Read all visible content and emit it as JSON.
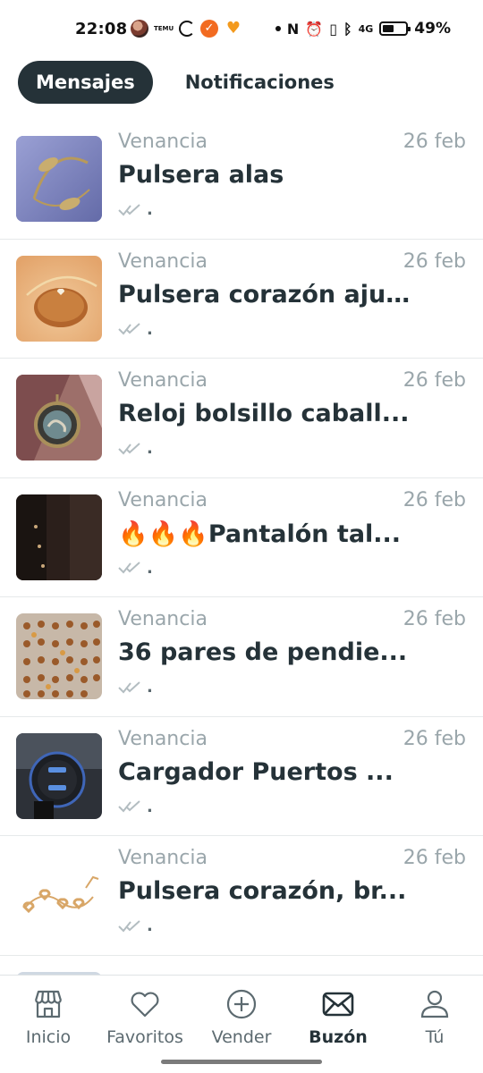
{
  "status_bar": {
    "time": "22:08",
    "temu_text": "TEMU",
    "battery_percent": "49%",
    "network": "4G"
  },
  "tabs": {
    "messages": "Mensajes",
    "notifications": "Notificaciones",
    "active": "messages"
  },
  "conversations": [
    {
      "sender": "Venancia",
      "date": "26 feb",
      "title": "Pulsera alas",
      "preview": ".",
      "thumb_icon": "bracelet-wings-photo"
    },
    {
      "sender": "Venancia",
      "date": "26 feb",
      "title": "Pulsera corazón aju...",
      "preview": ".",
      "thumb_icon": "heart-bracelet-photo"
    },
    {
      "sender": "Venancia",
      "date": "26 feb",
      "title": "Reloj bolsillo caball...",
      "preview": ".",
      "thumb_icon": "pocket-watch-photo"
    },
    {
      "sender": "Venancia",
      "date": "26 feb",
      "title": "🔥🔥🔥Pantalón tal...",
      "preview": ".",
      "thumb_icon": "trousers-photo"
    },
    {
      "sender": "Venancia",
      "date": "26 feb",
      "title": "36 pares de pendie...",
      "preview": ".",
      "thumb_icon": "earrings-photo"
    },
    {
      "sender": "Venancia",
      "date": "26 feb",
      "title": "Cargador Puertos ...",
      "preview": ".",
      "thumb_icon": "car-charger-photo"
    },
    {
      "sender": "Venancia",
      "date": "26 feb",
      "title": "Pulsera corazón, br...",
      "preview": ".",
      "thumb_icon": "heart-chain-bracelet-photo"
    }
  ],
  "bottom_nav": {
    "items": [
      {
        "label": "Inicio",
        "icon": "store-icon"
      },
      {
        "label": "Favoritos",
        "icon": "heart-icon"
      },
      {
        "label": "Vender",
        "icon": "plus-circle-icon"
      },
      {
        "label": "Buzón",
        "icon": "envelope-icon"
      },
      {
        "label": "Tú",
        "icon": "user-icon"
      }
    ],
    "active": "Buzón"
  },
  "colors": {
    "primary_dark": "#253238",
    "muted_text": "#9aa6ab",
    "divider": "#e6e9ea"
  }
}
